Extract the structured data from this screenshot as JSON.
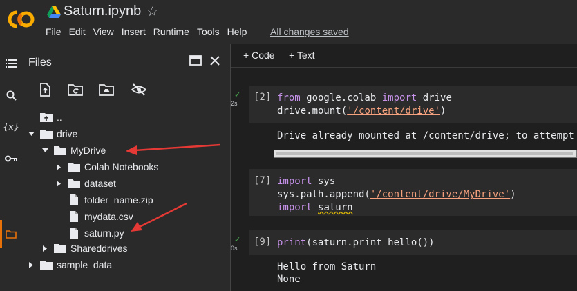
{
  "app": {
    "notebook_title": "Saturn.ipynb",
    "menu": [
      "File",
      "Edit",
      "View",
      "Insert",
      "Runtime",
      "Tools",
      "Help"
    ],
    "save_status": "All changes saved",
    "accent": "#e8710a"
  },
  "rail": {
    "icons": [
      "toc-icon",
      "search-icon",
      "variables-icon",
      "key-icon",
      "folder-icon"
    ],
    "variables_glyph": "{x}"
  },
  "files_panel": {
    "title": "Files",
    "tools": [
      "upload-icon",
      "refresh-folder-icon",
      "mount-drive-icon",
      "hide-icon"
    ],
    "tree": [
      {
        "label": "..",
        "type": "up",
        "depth": 0
      },
      {
        "label": "drive",
        "type": "folder",
        "expanded": true,
        "depth": 0
      },
      {
        "label": "MyDrive",
        "type": "folder",
        "expanded": true,
        "depth": 1
      },
      {
        "label": "Colab Notebooks",
        "type": "folder",
        "expanded": false,
        "depth": 2
      },
      {
        "label": "dataset",
        "type": "folder",
        "expanded": false,
        "depth": 2
      },
      {
        "label": "folder_name.zip",
        "type": "file",
        "depth": 2
      },
      {
        "label": "mydata.csv",
        "type": "file",
        "depth": 2
      },
      {
        "label": "saturn.py",
        "type": "file",
        "depth": 2
      },
      {
        "label": "Shareddrives",
        "type": "folder",
        "expanded": false,
        "depth": 1
      },
      {
        "label": "sample_data",
        "type": "folder",
        "expanded": false,
        "depth": 0
      }
    ]
  },
  "toolbar": {
    "code_label": "Code",
    "text_label": "Text"
  },
  "cells": [
    {
      "exec_count": "[2]",
      "run_time": "2s",
      "code_lines": [
        [
          "from",
          " google.colab ",
          "import",
          " drive"
        ],
        [
          "drive.mount(",
          "'/content/drive'",
          ")"
        ]
      ],
      "output": "Drive already mounted at /content/drive; to attempt"
    },
    {
      "exec_count": "[7]",
      "code_lines": [
        [
          "import",
          " sys"
        ],
        [
          "sys.path.append(",
          "'/content/drive/MyDrive'",
          ")"
        ],
        [
          "import",
          " ",
          "saturn"
        ]
      ]
    },
    {
      "exec_count": "[9]",
      "run_time": "0s",
      "code_lines": [
        [
          "print",
          "(saturn.print_hello())"
        ]
      ],
      "output_lines": [
        "Hello from Saturn",
        "None"
      ]
    }
  ]
}
